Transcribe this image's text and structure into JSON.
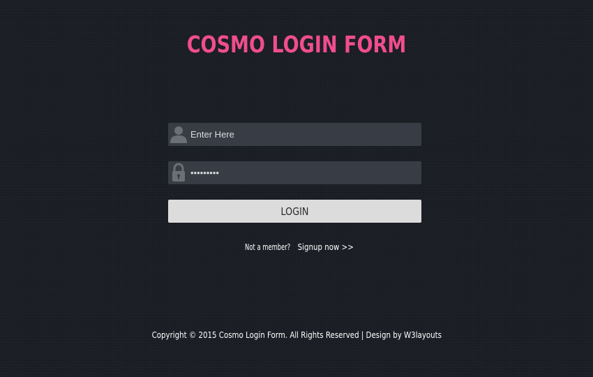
{
  "title": "COSMO LOGIN FORM",
  "form": {
    "username": {
      "icon": "user-icon",
      "placeholder": "Enter Here",
      "value": ""
    },
    "password": {
      "icon": "lock-icon",
      "value": "........."
    },
    "login_label": "LOGIN"
  },
  "signup": {
    "prompt": "Not a member?",
    "link_text": "Signup now >>"
  },
  "footer": {
    "copyright": "Copyright © 2015 Cosmo Login Form. All Rights Reserved | Design by",
    "designer_link": "W3layouts"
  },
  "colors": {
    "background": "#1b1e25",
    "title": "#f04d8f",
    "field_bg": "#383c44",
    "button_bg": "#dcdcdc"
  }
}
